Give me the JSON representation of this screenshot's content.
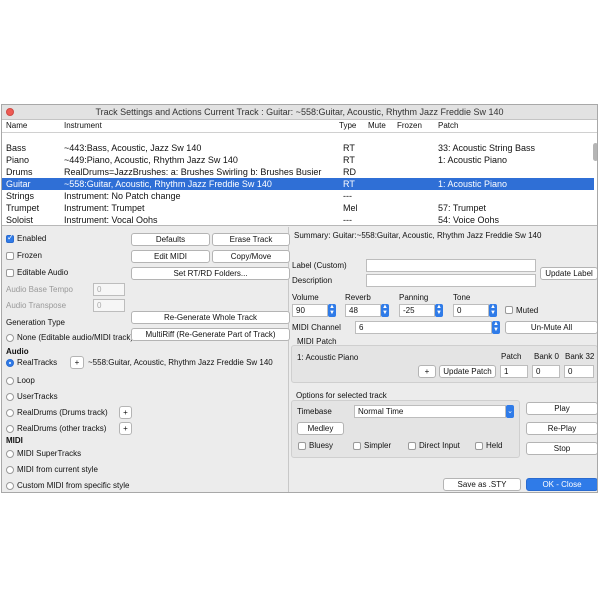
{
  "title": "Track Settings and Actions    Current Track : Guitar: ~558:Guitar, Acoustic, Rhythm Jazz Freddie Sw 140",
  "table": {
    "headers": [
      "Name",
      "Instrument",
      "Type",
      "Mute",
      "Frozen",
      "Patch"
    ],
    "rows": [
      {
        "name": "Bass",
        "instrument": "~443:Bass, Acoustic, Jazz Sw 140",
        "type": "RT",
        "patch": "33: Acoustic String Bass"
      },
      {
        "name": "Piano",
        "instrument": "~449:Piano, Acoustic, Rhythm Jazz Sw 140",
        "type": "RT",
        "patch": "1: Acoustic Piano"
      },
      {
        "name": "Drums",
        "instrument": "RealDrums=JazzBrushes: a: Brushes Swirling b: Brushes Busier",
        "type": "RD",
        "patch": ""
      },
      {
        "name": "Guitar",
        "instrument": "~558:Guitar, Acoustic, Rhythm Jazz Freddie Sw 140",
        "type": "RT",
        "patch": "1: Acoustic Piano"
      },
      {
        "name": "Strings",
        "instrument": "Instrument: No Patch change",
        "type": "---",
        "patch": ""
      },
      {
        "name": "Trumpet",
        "instrument": "Instrument: Trumpet",
        "type": "Mel",
        "patch": "57: Trumpet"
      },
      {
        "name": "Soloist",
        "instrument": "Instrument: Vocal Oohs",
        "type": "---",
        "patch": "54: Voice Oohs"
      }
    ]
  },
  "left": {
    "enabled": "Enabled",
    "frozen": "Frozen",
    "editable_audio": "Editable Audio",
    "audio_base_tempo": "Audio Base Tempo",
    "audio_base_tempo_value": "0",
    "audio_transpose": "Audio Transpose",
    "audio_transpose_value": "0",
    "generation_type": "Generation Type",
    "none_editable": "None (Editable audio/MIDI track)",
    "audio_header": "Audio",
    "realtracks": "RealTracks",
    "realtracks_value": "~558:Guitar, Acoustic, Rhythm Jazz Freddie Sw 140",
    "loop": "Loop",
    "usertracks": "UserTracks",
    "realdrums_drums": "RealDrums (Drums track)",
    "realdrums_other": "RealDrums (other tracks)",
    "midi_header": "MIDI",
    "midi_supertracks": "MIDI SuperTracks",
    "midi_current_style": "MIDI from current style",
    "custom_midi": "Custom MIDI from specific style",
    "plus": "+"
  },
  "buttons": {
    "defaults": "Defaults",
    "erase_track": "Erase Track",
    "edit_midi": "Edit MIDI",
    "copy_move": "Copy/Move",
    "set_rt_rd": "Set RT/RD Folders...",
    "regen_whole": "Re-Generate Whole Track",
    "multiriff": "MultiRiff (Re-Generate Part of Track)",
    "update_label": "Update Label",
    "unmute_all": "Un-Mute All",
    "update_patch": "Update Patch",
    "medley": "Medley",
    "play": "Play",
    "replay": "Re-Play",
    "stop": "Stop",
    "save_sty": "Save as .STY",
    "ok_close": "OK - Close"
  },
  "right": {
    "summary": "Summary: Guitar:~558:Guitar, Acoustic, Rhythm Jazz Freddie Sw 140",
    "label_custom": "Label (Custom)",
    "description": "Description",
    "volume_label": "Volume",
    "volume": "90",
    "reverb_label": "Reverb",
    "reverb": "48",
    "panning_label": "Panning",
    "panning": "-25",
    "tone_label": "Tone",
    "tone": "0",
    "muted": "Muted",
    "midi_channel_label": "MIDI Channel",
    "midi_channel": "6",
    "midi_patch_label": "MIDI Patch",
    "patch_name": "1: Acoustic Piano",
    "patch_col": "Patch",
    "bank0_col": "Bank 0",
    "bank32_col": "Bank 32",
    "patch_value": "1",
    "bank0_value": "0",
    "bank32_value": "0",
    "options_label": "Options for selected track",
    "timebase_label": "Timebase",
    "timebase_value": "Normal Time",
    "bluesy": "Bluesy",
    "simpler": "Simpler",
    "direct_input": "Direct Input",
    "held": "Held"
  }
}
